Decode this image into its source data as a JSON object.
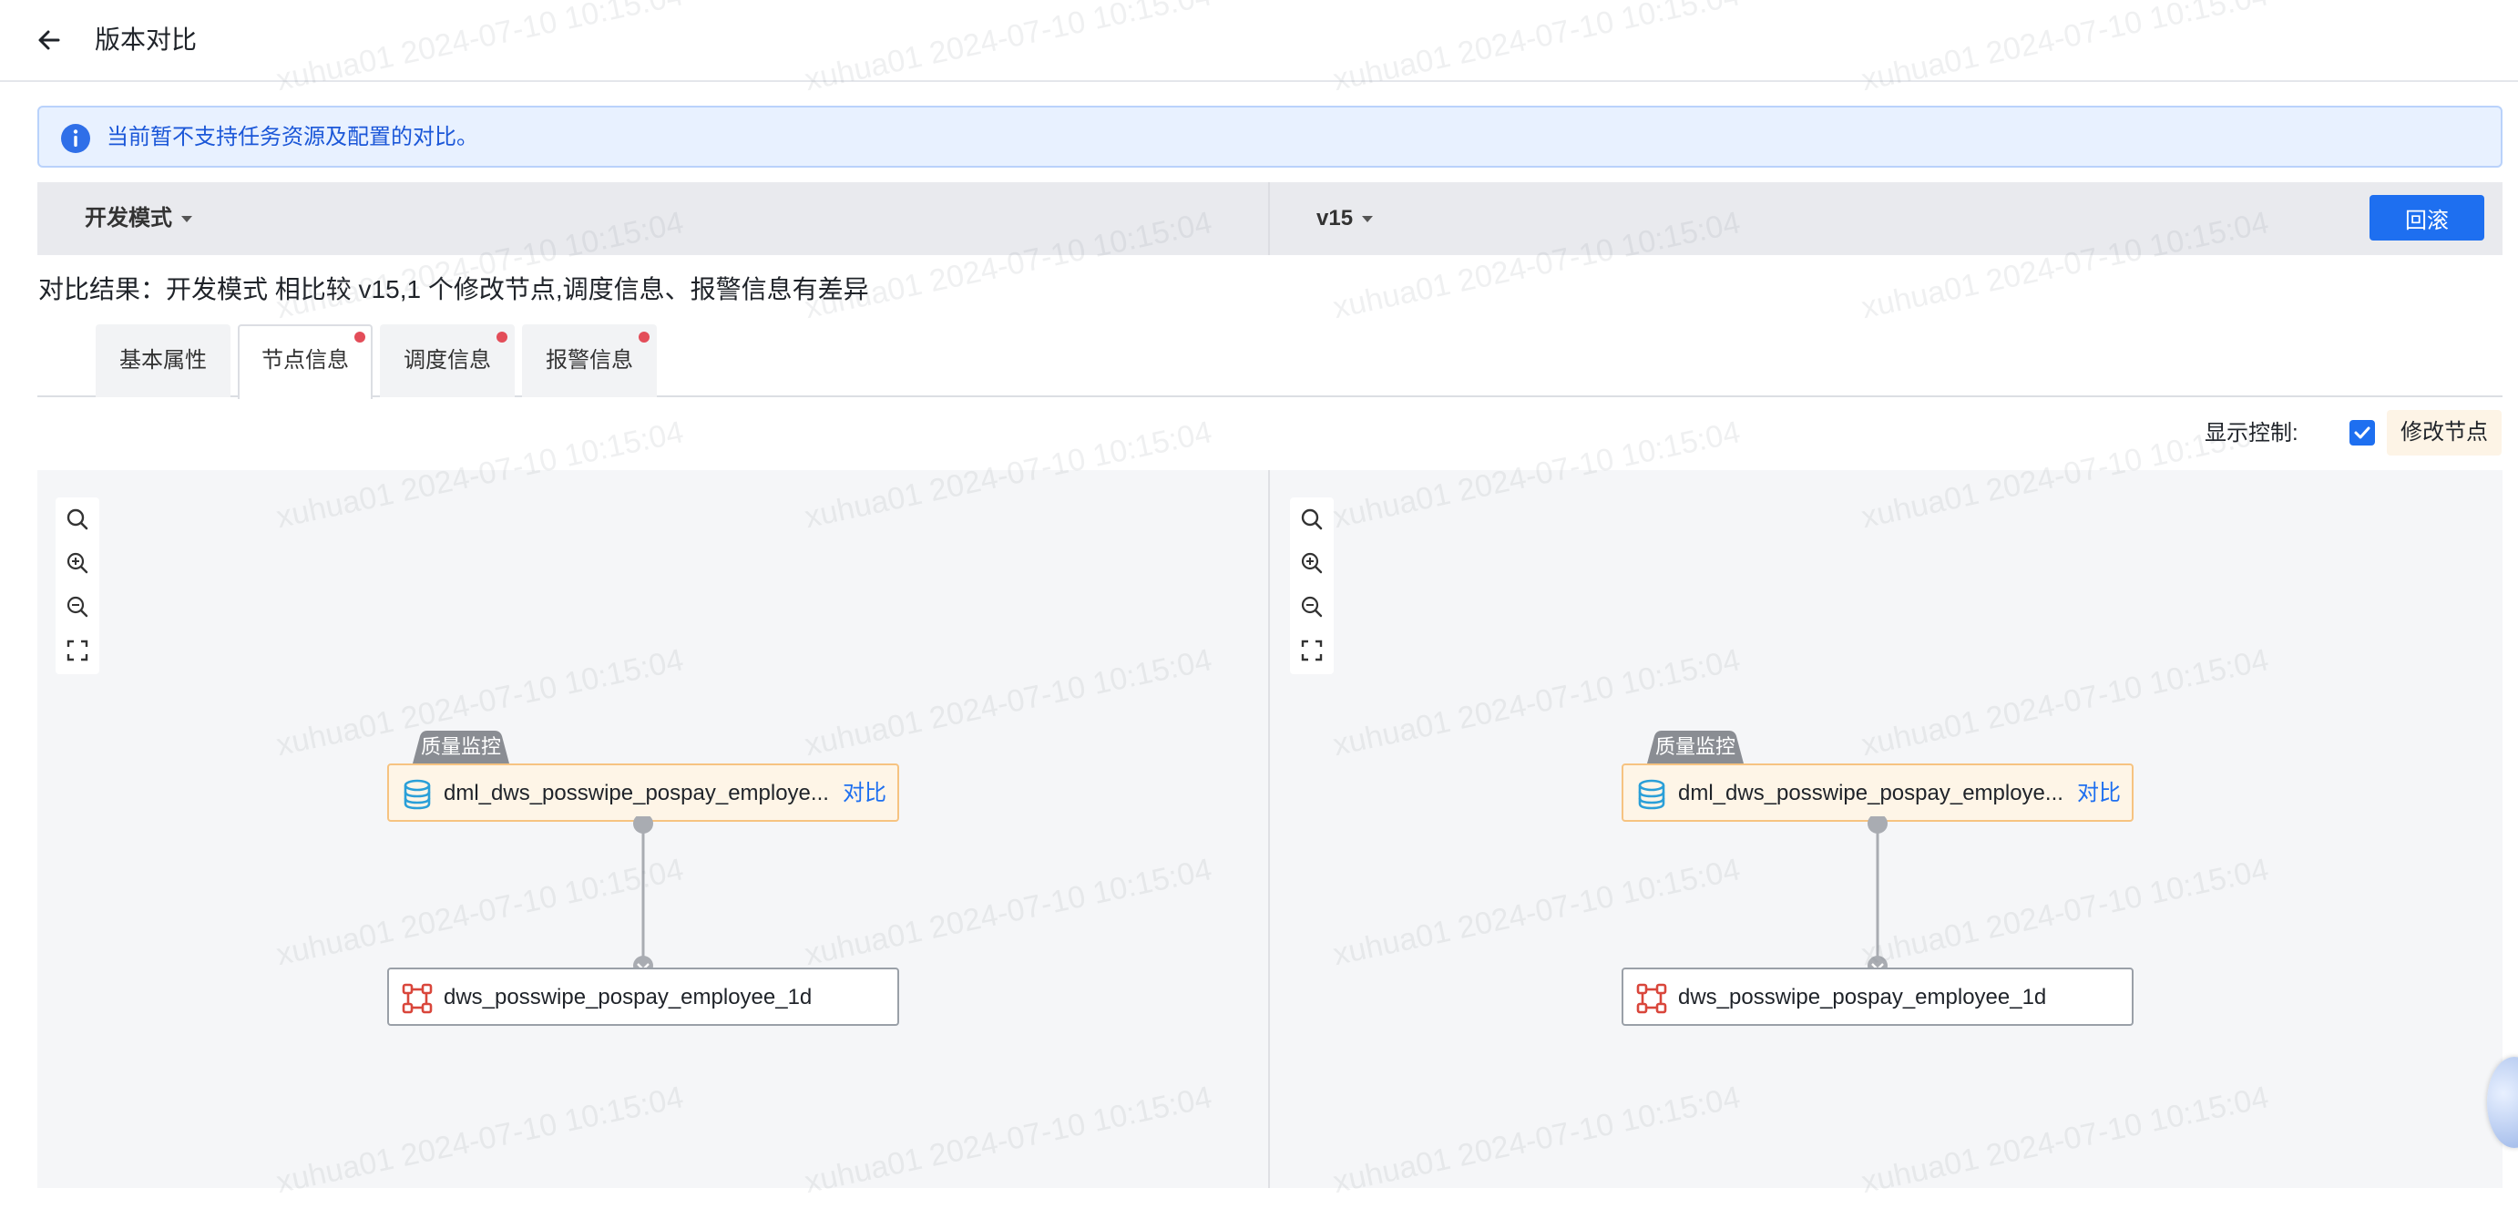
{
  "header": {
    "title": "版本对比"
  },
  "info_banner": {
    "text": "当前暂不支持任务资源及配置的对比。"
  },
  "version_bar": {
    "left_version": "开发模式",
    "right_version": "v15",
    "rollback_label": "回滚"
  },
  "compare_result": "对比结果：开发模式 相比较 v15,1 个修改节点,调度信息、报警信息有差异",
  "tabs": [
    {
      "label": "基本属性",
      "active": false,
      "changed": false
    },
    {
      "label": "节点信息",
      "active": true,
      "changed": true
    },
    {
      "label": "调度信息",
      "active": false,
      "changed": true
    },
    {
      "label": "报警信息",
      "active": false,
      "changed": true
    }
  ],
  "display_control": {
    "label": "显示控制:",
    "checked": true,
    "tag": "修改节点"
  },
  "graphs": [
    {
      "quality_tag": "质量监控",
      "top_node": {
        "name": "dml_dws_posswipe_pospay_employe...",
        "action": "对比",
        "icon": "database-icon"
      },
      "bottom_node": {
        "name": "dws_posswipe_pospay_employee_1d",
        "icon": "node-graph-icon"
      }
    },
    {
      "quality_tag": "质量监控",
      "top_node": {
        "name": "dml_dws_posswipe_pospay_employe...",
        "action": "对比",
        "icon": "database-icon"
      },
      "bottom_node": {
        "name": "dws_posswipe_pospay_employee_1d",
        "icon": "node-graph-icon"
      }
    }
  ],
  "watermark": "xuhua01 2024-07-10 10:15:04",
  "colors": {
    "primary": "#1e6ff0",
    "banner_bg": "#e8f1ff",
    "changed_dot": "#e34d59",
    "modified_node_bg": "#fef5e7",
    "modified_node_border": "#f6c381",
    "node_icon_red": "#d9463b",
    "db_icon_blue": "#2a9fd8"
  }
}
